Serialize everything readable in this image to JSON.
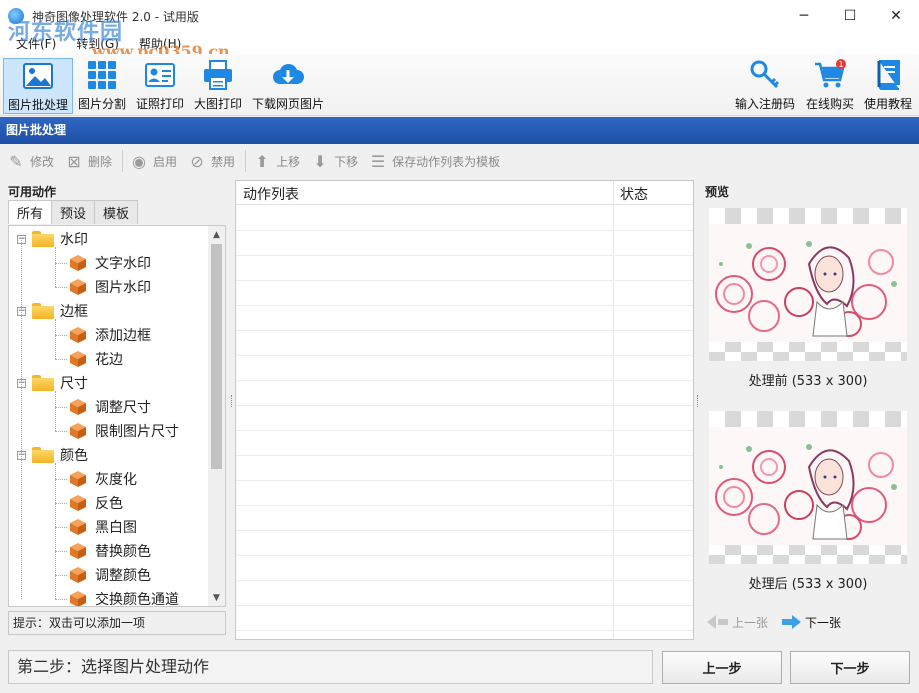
{
  "window": {
    "title": "神奇图像处理软件 2.0 - 试用版",
    "minimize": "─",
    "maximize": "☐",
    "close": "✕"
  },
  "watermark": {
    "text": "河东软件园",
    "url": "www.pc0359.cn"
  },
  "menu": [
    "文件(F)",
    "转到(G)",
    "帮助(H)"
  ],
  "toolbar": {
    "items": [
      {
        "label": "图片批处理",
        "icon": "image-icon"
      },
      {
        "label": "图片分割",
        "icon": "grid-icon"
      },
      {
        "label": "证照打印",
        "icon": "id-card-icon"
      },
      {
        "label": "大图打印",
        "icon": "printer-icon"
      },
      {
        "label": "下载网页图片",
        "icon": "cloud-download-icon"
      },
      {
        "label": "输入注册码",
        "icon": "key-icon"
      },
      {
        "label": "在线购买",
        "icon": "cart-icon",
        "badge": "1"
      },
      {
        "label": "使用教程",
        "icon": "book-icon"
      }
    ]
  },
  "section_title": "图片批处理",
  "action_bar": {
    "edit": "修改",
    "delete": "删除",
    "enable": "启用",
    "disable": "禁用",
    "move_up": "上移",
    "move_down": "下移",
    "save_template": "保存动作列表为模板"
  },
  "available_actions": {
    "title": "可用动作",
    "tabs": [
      "所有",
      "预设",
      "模板"
    ],
    "groups": [
      {
        "label": "水印",
        "items": [
          "文字水印",
          "图片水印"
        ]
      },
      {
        "label": "边框",
        "items": [
          "添加边框",
          "花边"
        ]
      },
      {
        "label": "尺寸",
        "items": [
          "调整尺寸",
          "限制图片尺寸"
        ]
      },
      {
        "label": "颜色",
        "items": [
          "灰度化",
          "反色",
          "黑白图",
          "替换颜色",
          "调整颜色",
          "交换颜色通道"
        ]
      }
    ],
    "hint": "提示：双击可以添加一项"
  },
  "action_list": {
    "col_action": "动作列表",
    "col_status": "状态"
  },
  "preview": {
    "title": "预览",
    "before": "处理前 (533 x 300)",
    "after": "处理后 (533 x 300)",
    "prev": "上一张",
    "next": "下一张"
  },
  "bottom": {
    "status": "第二步：选择图片处理动作",
    "prev_step": "上一步",
    "next_step": "下一步"
  }
}
